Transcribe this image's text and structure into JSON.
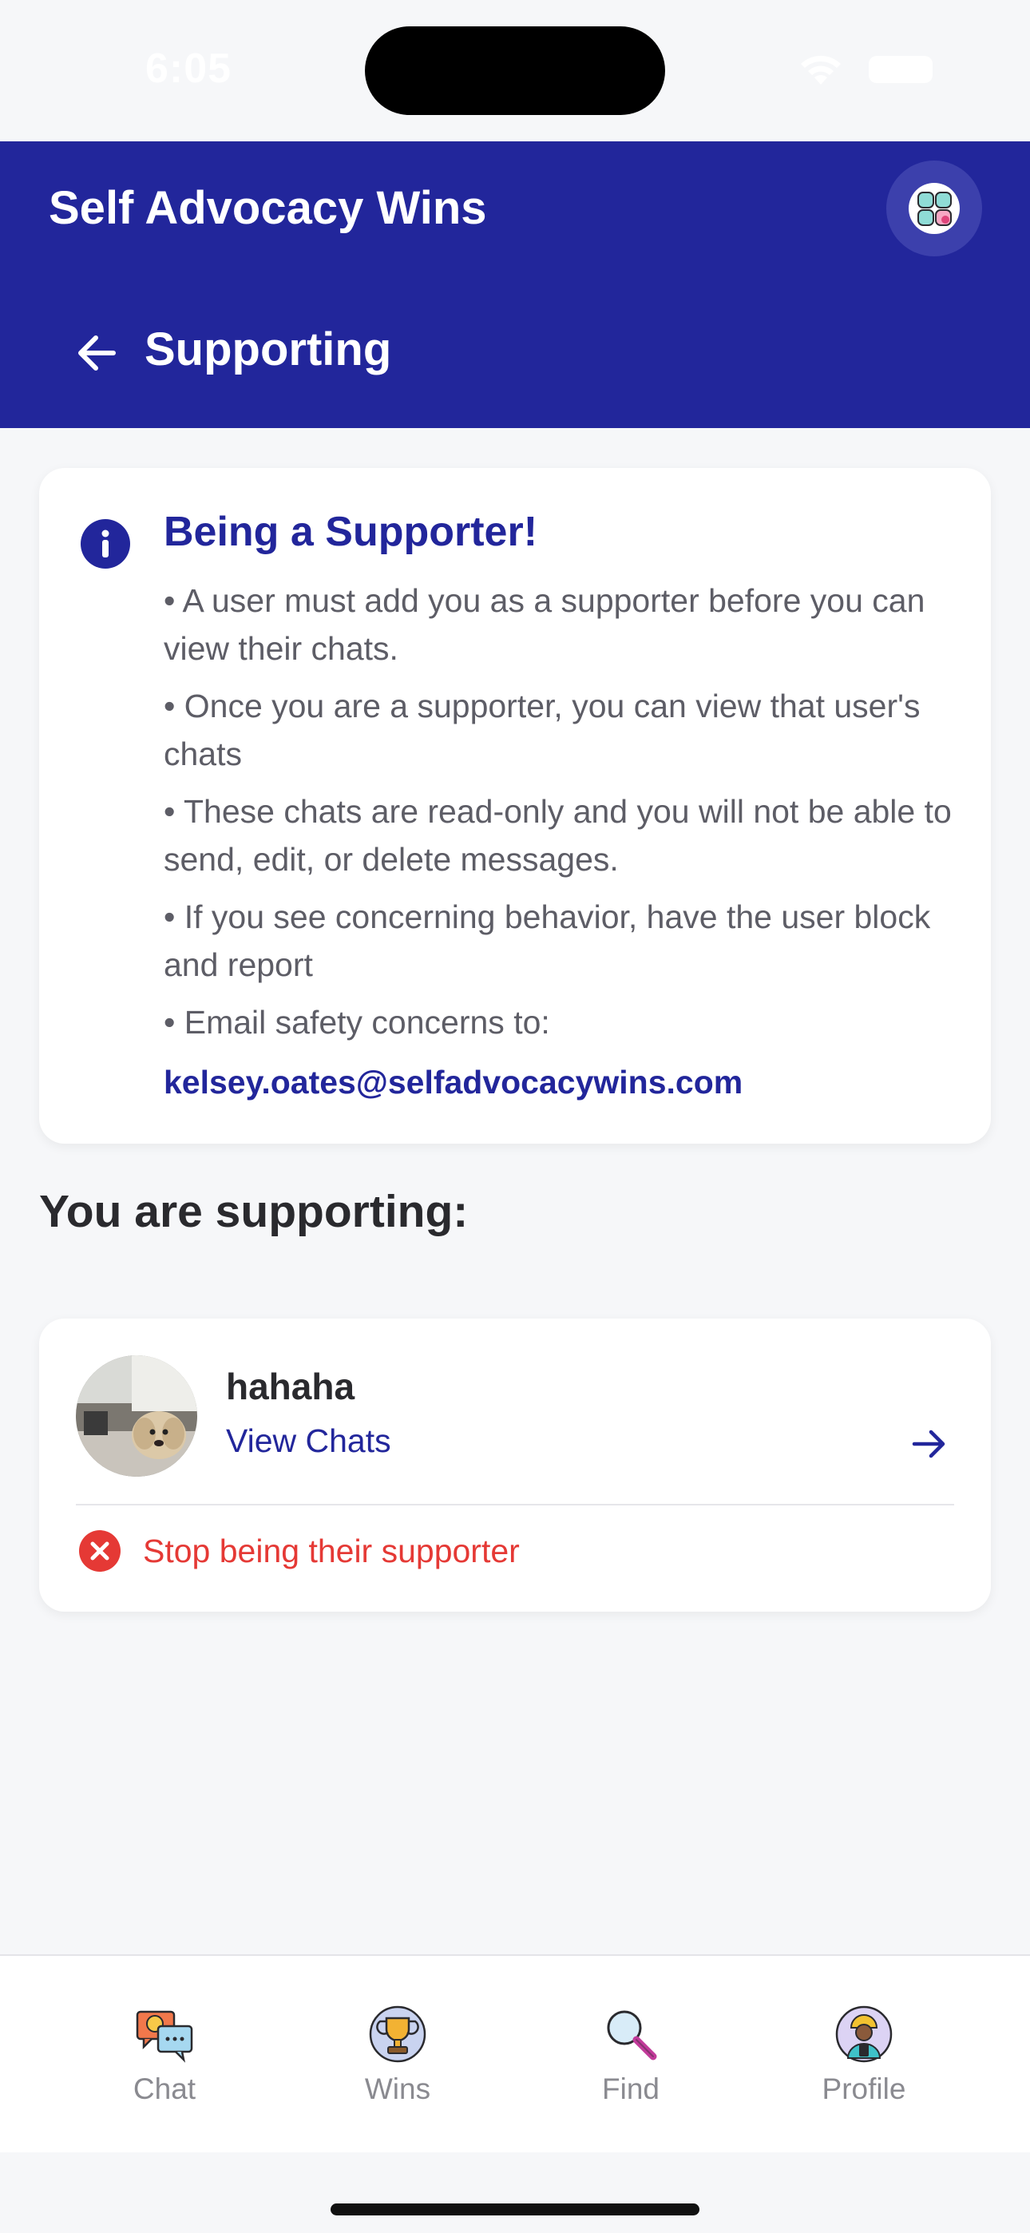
{
  "status_bar": {
    "time": "6:05"
  },
  "header": {
    "app_title": "Self Advocacy Wins",
    "page_title": "Supporting"
  },
  "info_card": {
    "title": "Being a Supporter!",
    "bullets": [
      "• A user must add you as a supporter before you can view their chats.",
      "• Once you are a supporter, you can view that user's chats",
      "• These chats are read-only and you will not be able to send, edit, or delete messages.",
      "• If you see concerning behavior, have the user block and report",
      "• Email safety concerns to:"
    ],
    "email": "kelsey.oates@selfadvocacywins.com"
  },
  "section_heading": "You are supporting:",
  "supported_user": {
    "name": "hahaha",
    "view_chats_label": "View Chats",
    "stop_label": "Stop being their supporter"
  },
  "tab_bar": {
    "tabs": [
      {
        "label": "Chat",
        "icon": "chat-icon"
      },
      {
        "label": "Wins",
        "icon": "trophy-icon"
      },
      {
        "label": "Find",
        "icon": "magnifier-icon"
      },
      {
        "label": "Profile",
        "icon": "profile-icon"
      }
    ]
  },
  "colors": {
    "primary": "#22269b",
    "danger": "#e53935",
    "background": "#f6f7f9"
  }
}
